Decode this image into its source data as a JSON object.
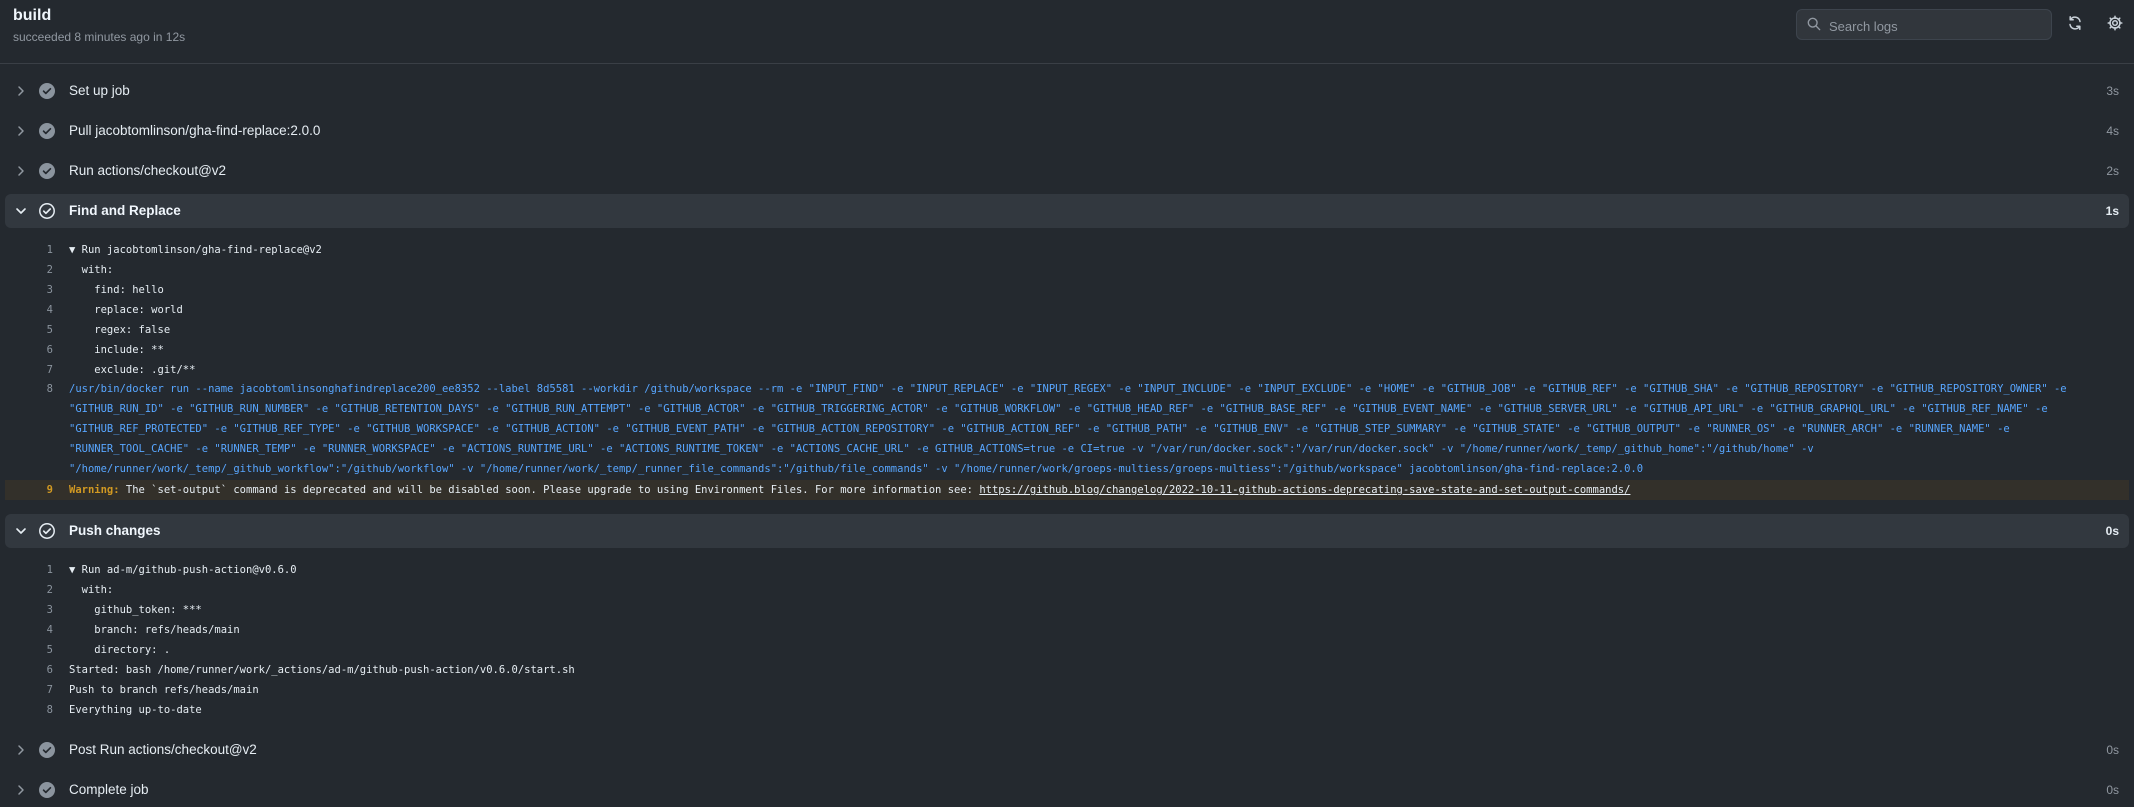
{
  "header": {
    "title": "build",
    "subtitle": "succeeded 8 minutes ago in 12s",
    "search_placeholder": "Search logs"
  },
  "colors": {
    "success": "#8b949e",
    "warning": "#d29922",
    "command": "#58a6ff"
  },
  "steps": [
    {
      "name": "Set up job",
      "duration": "3s",
      "expanded": false
    },
    {
      "name": "Pull jacobtomlinson/gha-find-replace:2.0.0",
      "duration": "4s",
      "expanded": false
    },
    {
      "name": "Run actions/checkout@v2",
      "duration": "2s",
      "expanded": false
    },
    {
      "name": "Find and Replace",
      "duration": "1s",
      "expanded": true,
      "lines": [
        {
          "num": "1",
          "text": "▼ Run jacobtomlinson/gha-find-replace@v2"
        },
        {
          "num": "2",
          "text": "  with:"
        },
        {
          "num": "3",
          "text": "    find: hello"
        },
        {
          "num": "4",
          "text": "    replace: world"
        },
        {
          "num": "5",
          "text": "    regex: false"
        },
        {
          "num": "6",
          "text": "    include: **"
        },
        {
          "num": "7",
          "text": "    exclude: .git/**"
        }
      ],
      "command": {
        "num": "8",
        "text": "/usr/bin/docker run --name jacobtomlinsonghafindreplace200_ee8352 --label 8d5581 --workdir /github/workspace --rm -e \"INPUT_FIND\" -e \"INPUT_REPLACE\" -e \"INPUT_REGEX\" -e \"INPUT_INCLUDE\" -e \"INPUT_EXCLUDE\" -e \"HOME\" -e \"GITHUB_JOB\" -e \"GITHUB_REF\" -e \"GITHUB_SHA\" -e \"GITHUB_REPOSITORY\" -e \"GITHUB_REPOSITORY_OWNER\" -e \"GITHUB_RUN_ID\" -e \"GITHUB_RUN_NUMBER\" -e \"GITHUB_RETENTION_DAYS\" -e \"GITHUB_RUN_ATTEMPT\" -e \"GITHUB_ACTOR\" -e \"GITHUB_TRIGGERING_ACTOR\" -e \"GITHUB_WORKFLOW\" -e \"GITHUB_HEAD_REF\" -e \"GITHUB_BASE_REF\" -e \"GITHUB_EVENT_NAME\" -e \"GITHUB_SERVER_URL\" -e \"GITHUB_API_URL\" -e \"GITHUB_GRAPHQL_URL\" -e \"GITHUB_REF_NAME\" -e \"GITHUB_REF_PROTECTED\" -e \"GITHUB_REF_TYPE\" -e \"GITHUB_WORKSPACE\" -e \"GITHUB_ACTION\" -e \"GITHUB_EVENT_PATH\" -e \"GITHUB_ACTION_REPOSITORY\" -e \"GITHUB_ACTION_REF\" -e \"GITHUB_PATH\" -e \"GITHUB_ENV\" -e \"GITHUB_STEP_SUMMARY\" -e \"GITHUB_STATE\" -e \"GITHUB_OUTPUT\" -e \"RUNNER_OS\" -e \"RUNNER_ARCH\" -e \"RUNNER_NAME\" -e \"RUNNER_TOOL_CACHE\" -e \"RUNNER_TEMP\" -e \"RUNNER_WORKSPACE\" -e \"ACTIONS_RUNTIME_URL\" -e \"ACTIONS_RUNTIME_TOKEN\" -e \"ACTIONS_CACHE_URL\" -e GITHUB_ACTIONS=true -e CI=true -v \"/var/run/docker.sock\":\"/var/run/docker.sock\" -v \"/home/runner/work/_temp/_github_home\":\"/github/home\" -v \"/home/runner/work/_temp/_github_workflow\":\"/github/workflow\" -v \"/home/runner/work/_temp/_runner_file_commands\":\"/github/file_commands\" -v \"/home/runner/work/groeps-multiess/groeps-multiess\":\"/github/workspace\" jacobtomlinson/gha-find-replace:2.0.0"
      },
      "warning": {
        "num": "9",
        "label": "Warning:",
        "text": " The `set-output` command is deprecated and will be disabled soon. Please upgrade to using Environment Files. For more information see: ",
        "link": "https://github.blog/changelog/2022-10-11-github-actions-deprecating-save-state-and-set-output-commands/"
      }
    },
    {
      "name": "Push changes",
      "duration": "0s",
      "expanded": true,
      "lines": [
        {
          "num": "1",
          "text": "▼ Run ad-m/github-push-action@v0.6.0"
        },
        {
          "num": "2",
          "text": "  with:"
        },
        {
          "num": "3",
          "text": "    github_token: ***"
        },
        {
          "num": "4",
          "text": "    branch: refs/heads/main"
        },
        {
          "num": "5",
          "text": "    directory: ."
        },
        {
          "num": "6",
          "text": "Started: bash /home/runner/work/_actions/ad-m/github-push-action/v0.6.0/start.sh"
        },
        {
          "num": "7",
          "text": "Push to branch refs/heads/main"
        },
        {
          "num": "8",
          "text": "Everything up-to-date"
        }
      ]
    },
    {
      "name": "Post Run actions/checkout@v2",
      "duration": "0s",
      "expanded": false
    },
    {
      "name": "Complete job",
      "duration": "0s",
      "expanded": false
    }
  ]
}
